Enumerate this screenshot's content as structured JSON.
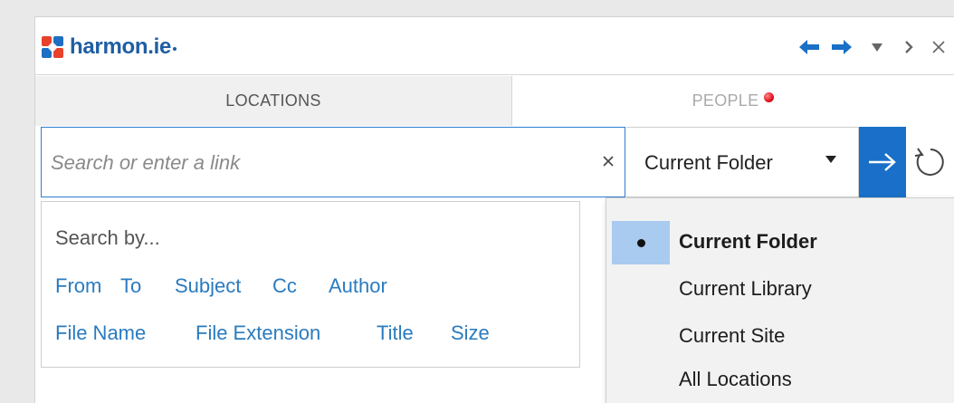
{
  "app": {
    "logo_text": "harmon.ie"
  },
  "tabs": [
    {
      "label": "LOCATIONS",
      "active": true
    },
    {
      "label": "PEOPLE",
      "active": false,
      "has_notification": true
    }
  ],
  "search": {
    "placeholder": "Search or enter a link",
    "value": "",
    "clear_icon": "close-icon"
  },
  "scope": {
    "selected": "Current Folder"
  },
  "search_by": {
    "title": "Search by...",
    "row1": [
      "From",
      "To",
      "Subject",
      "Cc",
      "Author"
    ],
    "row2": [
      "File Name",
      "File Extension",
      "Title",
      "Size"
    ]
  },
  "dropdown": {
    "options": [
      {
        "label": "Current Folder",
        "selected": true
      },
      {
        "label": "Current Library",
        "selected": false
      },
      {
        "label": "Current Site",
        "selected": false
      },
      {
        "label": "All Locations",
        "selected": false
      }
    ]
  },
  "colors": {
    "brand": "#1f5ea3",
    "accent": "#1a70c8",
    "link": "#2a7bbf",
    "selection": "#a9cbef",
    "notification": "#e0121b"
  }
}
